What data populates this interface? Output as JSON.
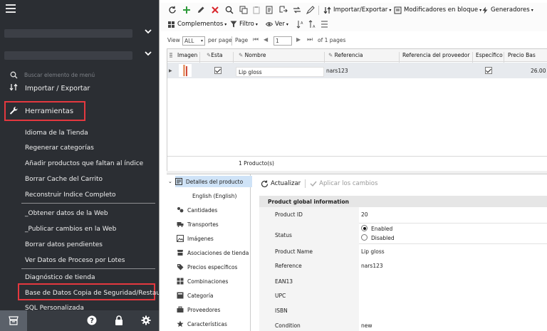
{
  "sidebar": {
    "search_placeholder": "Buscar elemento de menú",
    "top_item": "Importar / Exportar",
    "section": "Herramientas",
    "items": [
      "Idioma de la Tienda",
      "Regenerar categorías",
      "Añadir productos que faltan al índice",
      "Borrar Cache del Carrito",
      "Reconstruir Indice Completo",
      "_Obtener datos de la Web",
      "_Publicar cambios en la Web",
      "Borrar datos pendientes",
      "Ver Datos de Proceso por Lotes",
      "Diagnóstico de tienda",
      "Base de Datos Copia de Seguridad/Restaurar",
      "SQL Personalizada"
    ],
    "bottom_icons": [
      "store-icon",
      "help-icon",
      "lock-icon",
      "settings-icon"
    ]
  },
  "toolbar": {
    "import_export": "Importar/Exportar",
    "modifiers": "Modificadores en bloque",
    "generators": "Generadores",
    "complements": "Complementos",
    "filter": "Filtro",
    "view": "Ver"
  },
  "pager": {
    "view_label": "View",
    "view_value": "ALL",
    "per_page": "per page",
    "page_label": "Page",
    "page_value": "1",
    "of_pages": "of 1 pages"
  },
  "grid": {
    "columns": [
      "Imagen",
      "Esta",
      "Nombre",
      "Referencia",
      "Referencia del proveedor",
      "Específico",
      "Precio Bas"
    ],
    "row": {
      "name": "Lip gloss",
      "reference": "nars123",
      "price": "26.00"
    },
    "footer": "1 Producto(s)"
  },
  "tree": {
    "items": [
      "Detalles del producto",
      "English (English)",
      "Cantidades",
      "Transportes",
      "Imágenes",
      "Asociaciones de tienda",
      "Precios específicos",
      "Combinaciones",
      "Categoría",
      "Proveedores",
      "Características"
    ]
  },
  "details": {
    "refresh": "Actualizar",
    "apply": "Aplicar los cambios",
    "section_title": "Product global information",
    "product_id_label": "Product ID",
    "product_id": "20",
    "status_label": "Status",
    "enabled": "Enabled",
    "disabled": "Disabled",
    "name_label": "Product Name",
    "name": "Lip gloss",
    "reference_label": "Reference",
    "reference": "nars123",
    "ean_label": "EAN13",
    "upc_label": "UPC",
    "isbn_label": "ISBN",
    "condition_label": "Condition",
    "condition": "new"
  },
  "colors": {
    "sidebar_bg": "#2b2e33",
    "highlight": "#e4383f",
    "selected_row": "#e7eaee",
    "tree_selected": "#cfe3f7"
  }
}
